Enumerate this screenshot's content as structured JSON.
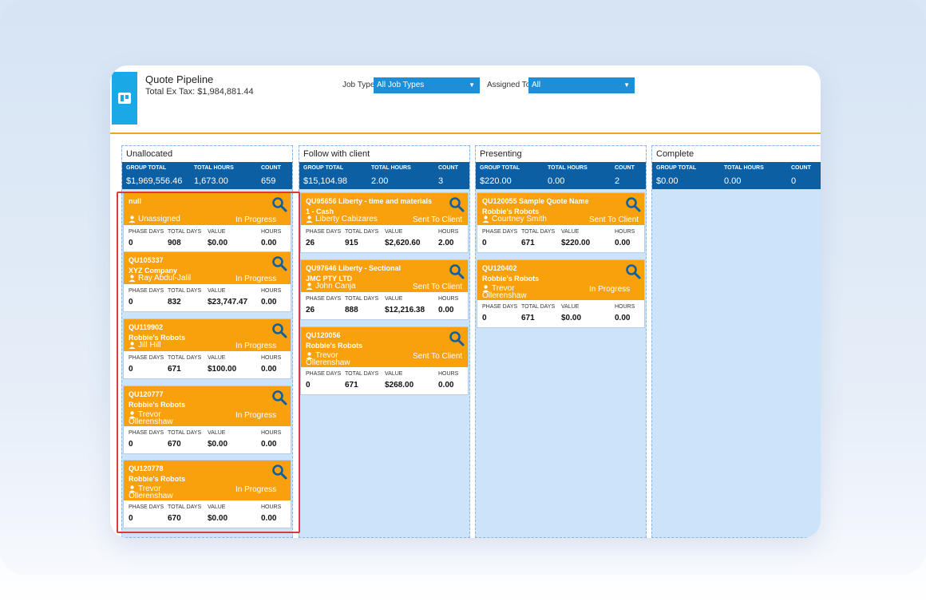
{
  "app": {
    "title": "Quote Pipeline",
    "total_ex_tax": "Total Ex Tax: $1,984,881.44"
  },
  "filters": {
    "job_type_label": "Job Type",
    "job_type_value": "All Job Types",
    "assigned_to_label": "Assigned To",
    "assigned_to_value": "All"
  },
  "stat_labels": {
    "group_total": "GROUP TOTAL",
    "total_hours": "TOTAL HOURS",
    "count": "COUNT"
  },
  "metric_labels": {
    "phase_days": "PHASE DAYS",
    "total_days": "TOTAL DAYS",
    "value": "VALUE",
    "hours": "HOURS"
  },
  "colors": {
    "accent_orange": "#f9a10d",
    "header_blue": "#0d5fa3",
    "select_blue": "#1e8fd6",
    "column_bg": "#cce4fa",
    "logo_blue": "#1aa8e6",
    "highlight_red": "#d93a3a"
  },
  "icons": {
    "logo": "board-icon",
    "search": "magnifier-icon",
    "user": "person-icon",
    "dropdown": "caret-down-icon"
  },
  "columns": [
    {
      "name": "Unallocated",
      "group_total": "$1,969,556.46",
      "total_hours": "1,673.00",
      "count": "659",
      "cards": [
        {
          "line1": "null",
          "line2": "",
          "assignee": "Unassigned",
          "assignee2": "",
          "status": "In Progress",
          "phase_days": "0",
          "total_days": "908",
          "value": "$0.00",
          "hours": "0.00"
        },
        {
          "line1": "QU105337",
          "line2": "XYZ Company",
          "assignee": "Ray Abdul-Jalil",
          "assignee2": "",
          "status": "In Progress",
          "phase_days": "0",
          "total_days": "832",
          "value": "$23,747.47",
          "hours": "0.00"
        },
        {
          "line1": "QU119902",
          "line2": "Robbie's Robots",
          "assignee": "Jill Hill",
          "assignee2": "",
          "status": "In Progress",
          "phase_days": "0",
          "total_days": "671",
          "value": "$100.00",
          "hours": "0.00"
        },
        {
          "line1": "QU120777",
          "line2": "Robbie's Robots",
          "assignee": "Trevor",
          "assignee2": "Ollerenshaw",
          "status": "In Progress",
          "phase_days": "0",
          "total_days": "670",
          "value": "$0.00",
          "hours": "0.00"
        },
        {
          "line1": "QU120778",
          "line2": "Robbie's Robots",
          "assignee": "Trevor",
          "assignee2": "Ollerenshaw",
          "status": "In Progress",
          "phase_days": "0",
          "total_days": "670",
          "value": "$0.00",
          "hours": "0.00"
        }
      ]
    },
    {
      "name": "Follow with client",
      "group_total": "$15,104.98",
      "total_hours": "2.00",
      "count": "3",
      "cards": [
        {
          "line1": "QU95656 Liberty - time and materials",
          "line2": "1 - Cash",
          "assignee": "Liberty Cabizares",
          "assignee2": "",
          "status": "Sent To Client",
          "phase_days": "26",
          "total_days": "915",
          "value": "$2,620.60",
          "hours": "2.00"
        },
        {
          "line1": "QU97646 Liberty - Sectional",
          "line2": "JMC PTY LTD",
          "assignee": "John Canja",
          "assignee2": "",
          "status": "Sent To Client",
          "phase_days": "26",
          "total_days": "888",
          "value": "$12,216.38",
          "hours": "0.00"
        },
        {
          "line1": "QU120056",
          "line2": "Robbie's Robots",
          "assignee": "Trevor",
          "assignee2": "Ollerenshaw",
          "status": "Sent To Client",
          "phase_days": "0",
          "total_days": "671",
          "value": "$268.00",
          "hours": "0.00"
        }
      ]
    },
    {
      "name": "Presenting",
      "group_total": "$220.00",
      "total_hours": "0.00",
      "count": "2",
      "cards": [
        {
          "line1": "QU120055 Sample Quote Name",
          "line2": "Robbie's Robots",
          "assignee": "Courtney Smith",
          "assignee2": "",
          "status": "Sent To Client",
          "phase_days": "0",
          "total_days": "671",
          "value": "$220.00",
          "hours": "0.00"
        },
        {
          "line1": "QU120402",
          "line2": "Robbie's Robots",
          "assignee": "Trevor",
          "assignee2": "Ollerenshaw",
          "status": "In Progress",
          "phase_days": "0",
          "total_days": "671",
          "value": "$0.00",
          "hours": "0.00"
        }
      ]
    },
    {
      "name": "Complete",
      "group_total": "$0.00",
      "total_hours": "0.00",
      "count": "0",
      "cards": []
    }
  ]
}
